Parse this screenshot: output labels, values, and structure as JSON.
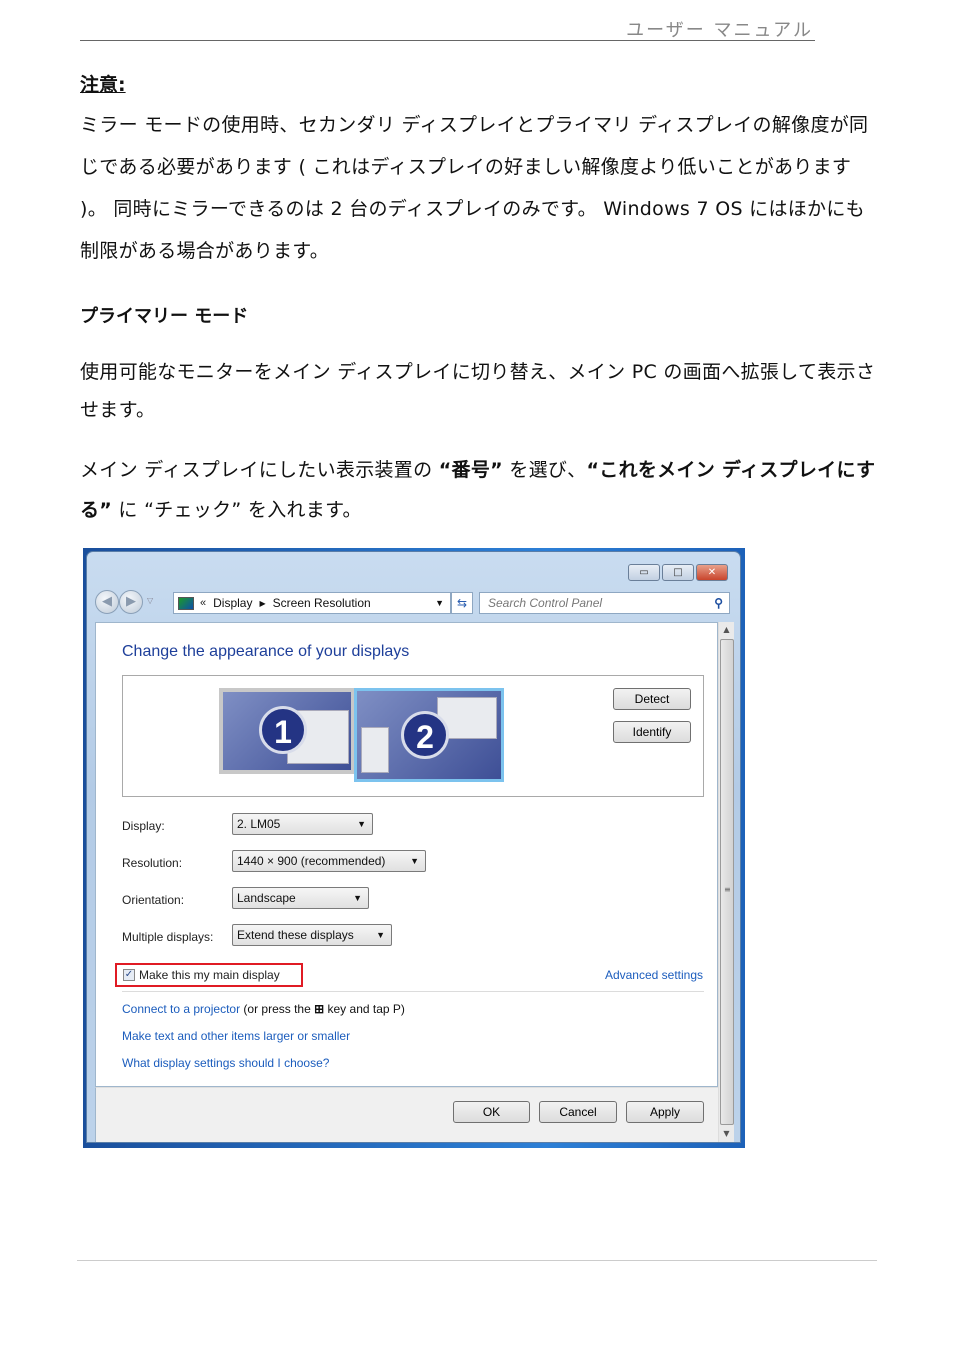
{
  "page_header": "ユーザー マニュアル",
  "note": {
    "title": "注意:",
    "body": " ミラー モードの使用時、セカンダリ ディスプレイとプライマリ ディスプレイの解像度が同じである必要があります ( これはディスプレイの好ましい解像度より低いことがあります )。 同時にミラーできるのは 2 台のディスプレイのみです。 Windows 7 OS にはほかにも制限がある場合があります。"
  },
  "section": {
    "title": "プライマリー モード",
    "para1": "使用可能なモニターをメイン ディスプレイに切り替え、メイン PC の画面へ拡張して表示させます。",
    "para2_parts": {
      "a": "メイン ディスプレイにしたい表示装置の ",
      "b": "“番号”",
      "c": " を選び、",
      "d": "“これをメイン ディスプレイにする”",
      "e": " に “チェック” を入れます。"
    }
  },
  "window": {
    "controls": {
      "minimize": "▭",
      "maximize": "□",
      "close": "✕"
    },
    "breadcrumb": {
      "prefix": "«",
      "items": [
        "Display",
        "Screen Resolution"
      ]
    },
    "search_placeholder": "Search Control Panel",
    "heading": "Change the appearance of your displays",
    "monitors": [
      {
        "number": "1",
        "selected": false
      },
      {
        "number": "2",
        "selected": true
      }
    ],
    "detect_label": "Detect",
    "identify_label": "Identify",
    "fields": [
      {
        "label": "Display:",
        "value": "2. LM05"
      },
      {
        "label": "Resolution:",
        "value": "1440 × 900 (recommended)"
      },
      {
        "label": "Orientation:",
        "value": "Landscape"
      },
      {
        "label": "Multiple displays:",
        "value": "Extend these displays"
      }
    ],
    "main_display_checkbox": {
      "label": "Make this my main display",
      "checked": true
    },
    "advanced_settings": "Advanced settings",
    "projector_link": "Connect to a projector",
    "projector_hint_a": " (or press the ",
    "projector_hint_b": " key and tap P)",
    "link_text_size": "Make text and other items larger or smaller",
    "link_help": "What display settings should I choose?",
    "ok_label": "OK",
    "cancel_label": "Cancel",
    "apply_label": "Apply"
  }
}
